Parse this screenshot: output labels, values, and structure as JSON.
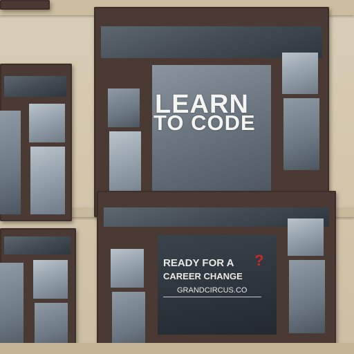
{
  "scene": {
    "description_colors": {
      "wall": "#d4c7ad",
      "frame": "#4a3a33",
      "accent_red": "#c9282a"
    }
  },
  "signs": {
    "upper_line1": "LEARN",
    "upper_line2": "TO CODE",
    "lower_line1": "READY FOR A",
    "lower_line2": "CAREER CHANGE",
    "lower_url": "GRANDCIRCUS.CO",
    "lower_mark": "?"
  }
}
